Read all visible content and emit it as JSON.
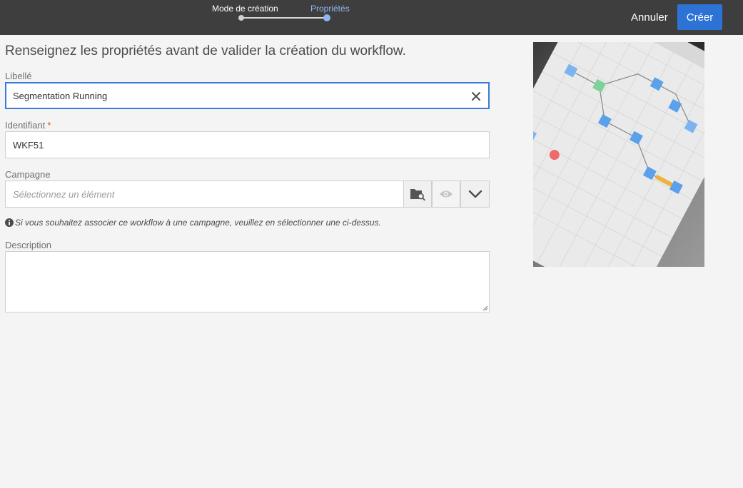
{
  "wizard": {
    "steps": [
      "Mode de création",
      "Propriétés"
    ],
    "active_step": 2
  },
  "actions": {
    "cancel_label": "Annuler",
    "create_label": "Créer"
  },
  "form": {
    "heading": "Renseignez les propriétés avant de valider la création du workflow.",
    "libelle": {
      "label": "Libellé",
      "value": "Segmentation Running"
    },
    "identifiant": {
      "label": "Identifiant",
      "required_mark": "*",
      "value": "WKF51"
    },
    "campagne": {
      "label": "Campagne",
      "placeholder": "Sélectionnez un élément",
      "help": "Si vous souhaitez associer ce workflow à une campagne, veuillez en sélectionner une ci-dessus."
    },
    "description": {
      "label": "Description",
      "value": ""
    }
  },
  "colors": {
    "topbar": "#3e3e3e",
    "primary": "#2d73d6",
    "active_step": "#8fb8f0",
    "background": "#f4f4f4"
  }
}
